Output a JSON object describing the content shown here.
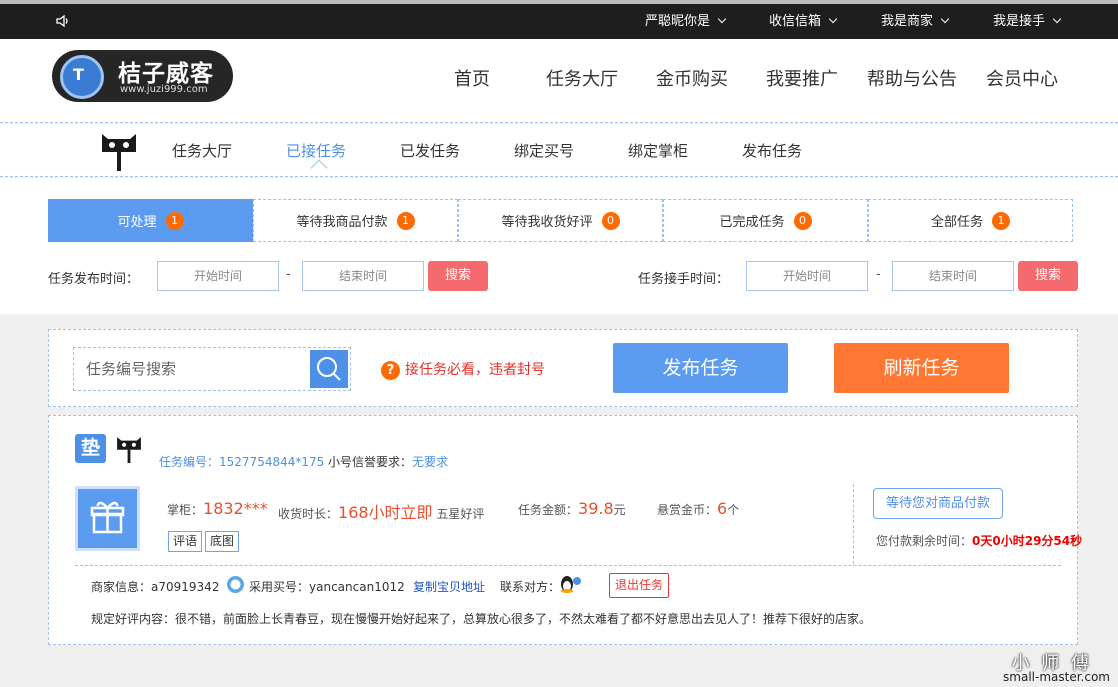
{
  "topbar": {
    "user": "严聪昵你是",
    "messages": "收信信箱",
    "merchant": "我是商家",
    "receiver": "我是接手"
  },
  "logo": {
    "name": "桔子威客",
    "url": "www.juzi999.com",
    "mark": "T"
  },
  "nav": [
    "首页",
    "任务大厅",
    "金币购买",
    "我要推广",
    "帮助与公告",
    "会员中心"
  ],
  "subnav": [
    "任务大厅",
    "已接任务",
    "已发任务",
    "绑定买号",
    "绑定掌柜",
    "发布任务"
  ],
  "tabs": [
    {
      "label": "可处理",
      "count": "1"
    },
    {
      "label": "等待我商品付款",
      "count": "1"
    },
    {
      "label": "等待我收货好评",
      "count": "0"
    },
    {
      "label": "已完成任务",
      "count": "0"
    },
    {
      "label": "全部任务",
      "count": "1"
    }
  ],
  "filters": {
    "publish_label": "任务发布时间：",
    "accept_label": "任务接手时间：",
    "start_placeholder": "开始时间",
    "end_placeholder": "结束时间",
    "search_label": "搜索",
    "dash": "-"
  },
  "toolbar": {
    "search_placeholder": "任务编号搜索",
    "warning": "接任务必看，违者封号",
    "warning_icon": "?",
    "publish": "发布任务",
    "refresh": "刷新任务"
  },
  "task": {
    "pad_icon": "垫",
    "id_label": "任务编号：",
    "id": "1527754844*175",
    "credit_label": "小号信誉要求：",
    "credit": "无要求",
    "shop_label": "掌柜：",
    "shop": "1832***",
    "duration_label": "收货时长：",
    "duration": "168小时立即",
    "rating": "五星好评",
    "amount_label": "任务金额：",
    "amount": "39.8",
    "amount_unit": "元",
    "reward_label": "悬赏金币：",
    "reward": "6",
    "reward_unit": "个",
    "tag_review": "评语",
    "tag_image": "底图",
    "status": "等待您对商品付款",
    "remain_label": "您付款剩余时间：",
    "remain": "0天0小时29分54秒",
    "merchant_label": "商家信息：",
    "merchant": "a70919342",
    "buyer_label": "采用买号：",
    "buyer": "yancancan1012",
    "copy_link": "复制宝贝地址",
    "contact_label": "联系对方：",
    "quit": "退出任务",
    "comment_label": "规定好评内容：",
    "comment": "很不错，前面脸上长青春豆，现在慢慢开始好起来了，总算放心很多了，不然太难看了都不好意思出去见人了！推荐下很好的店家。"
  },
  "watermark": {
    "brand": "小 师 傅",
    "site": "small-master.com"
  },
  "colors": {
    "accent": "#4d90e6",
    "orange": "#ff7733",
    "badge": "#ff6a00",
    "search": "#f56a6e"
  }
}
